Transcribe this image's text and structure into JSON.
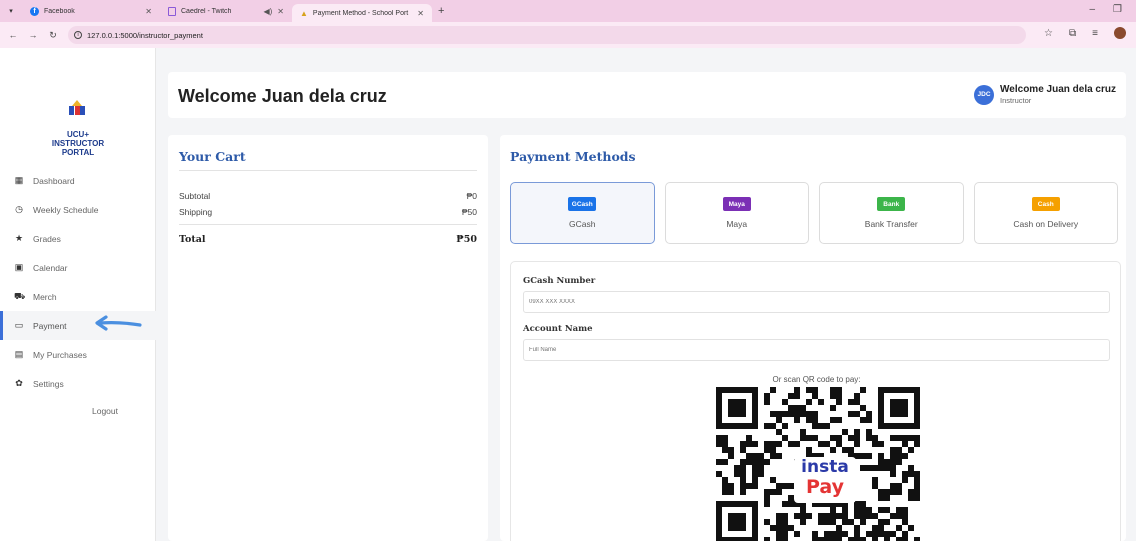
{
  "browser": {
    "tabs": [
      {
        "title": "Facebook"
      },
      {
        "title": "Caedrel - Twitch"
      },
      {
        "title": "Payment Method - School Port"
      }
    ],
    "url": "127.0.0.1:5000/instructor_payment"
  },
  "sidebar": {
    "brand_line1": "UCU+",
    "brand_line2": "INSTRUCTOR",
    "brand_line3": "PORTAL",
    "items": [
      {
        "label": "Dashboard",
        "icon": "grid-icon"
      },
      {
        "label": "Weekly Schedule",
        "icon": "clock-icon"
      },
      {
        "label": "Grades",
        "icon": "star-icon"
      },
      {
        "label": "Calendar",
        "icon": "calendar-icon"
      },
      {
        "label": "Merch",
        "icon": "cart-icon"
      },
      {
        "label": "Payment",
        "icon": "credit-card-icon"
      },
      {
        "label": "My Purchases",
        "icon": "receipt-icon"
      },
      {
        "label": "Settings",
        "icon": "gear-icon"
      }
    ],
    "logout": "Logout"
  },
  "header": {
    "title": "Welcome Juan dela cruz",
    "avatar_initials": "JDC",
    "user_name": "Welcome Juan dela cruz",
    "user_role": "Instructor"
  },
  "cart": {
    "title": "Your Cart",
    "subtotal_label": "Subtotal",
    "subtotal_value": "₱0",
    "shipping_label": "Shipping",
    "shipping_value": "₱50",
    "total_label": "Total",
    "total_value": "₱50"
  },
  "payment": {
    "title": "Payment Methods",
    "methods": [
      {
        "badge": "GCash",
        "label": "GCash",
        "color": "#1a73e8"
      },
      {
        "badge": "Maya",
        "label": "Maya",
        "color": "#7b2fb5"
      },
      {
        "badge": "Bank",
        "label": "Bank Transfer",
        "color": "#3cb54a"
      },
      {
        "badge": "Cash",
        "label": "Cash on Delivery",
        "color": "#f5a000"
      }
    ],
    "gcash_number_label": "GCash Number",
    "gcash_number_placeholder": "09XX XXX XXXX",
    "account_name_label": "Account Name",
    "account_name_placeholder": "Full Name",
    "qr_caption": "Or scan QR code to pay:",
    "qr_logo_line1": "insta",
    "qr_logo_line2": "Pay"
  }
}
